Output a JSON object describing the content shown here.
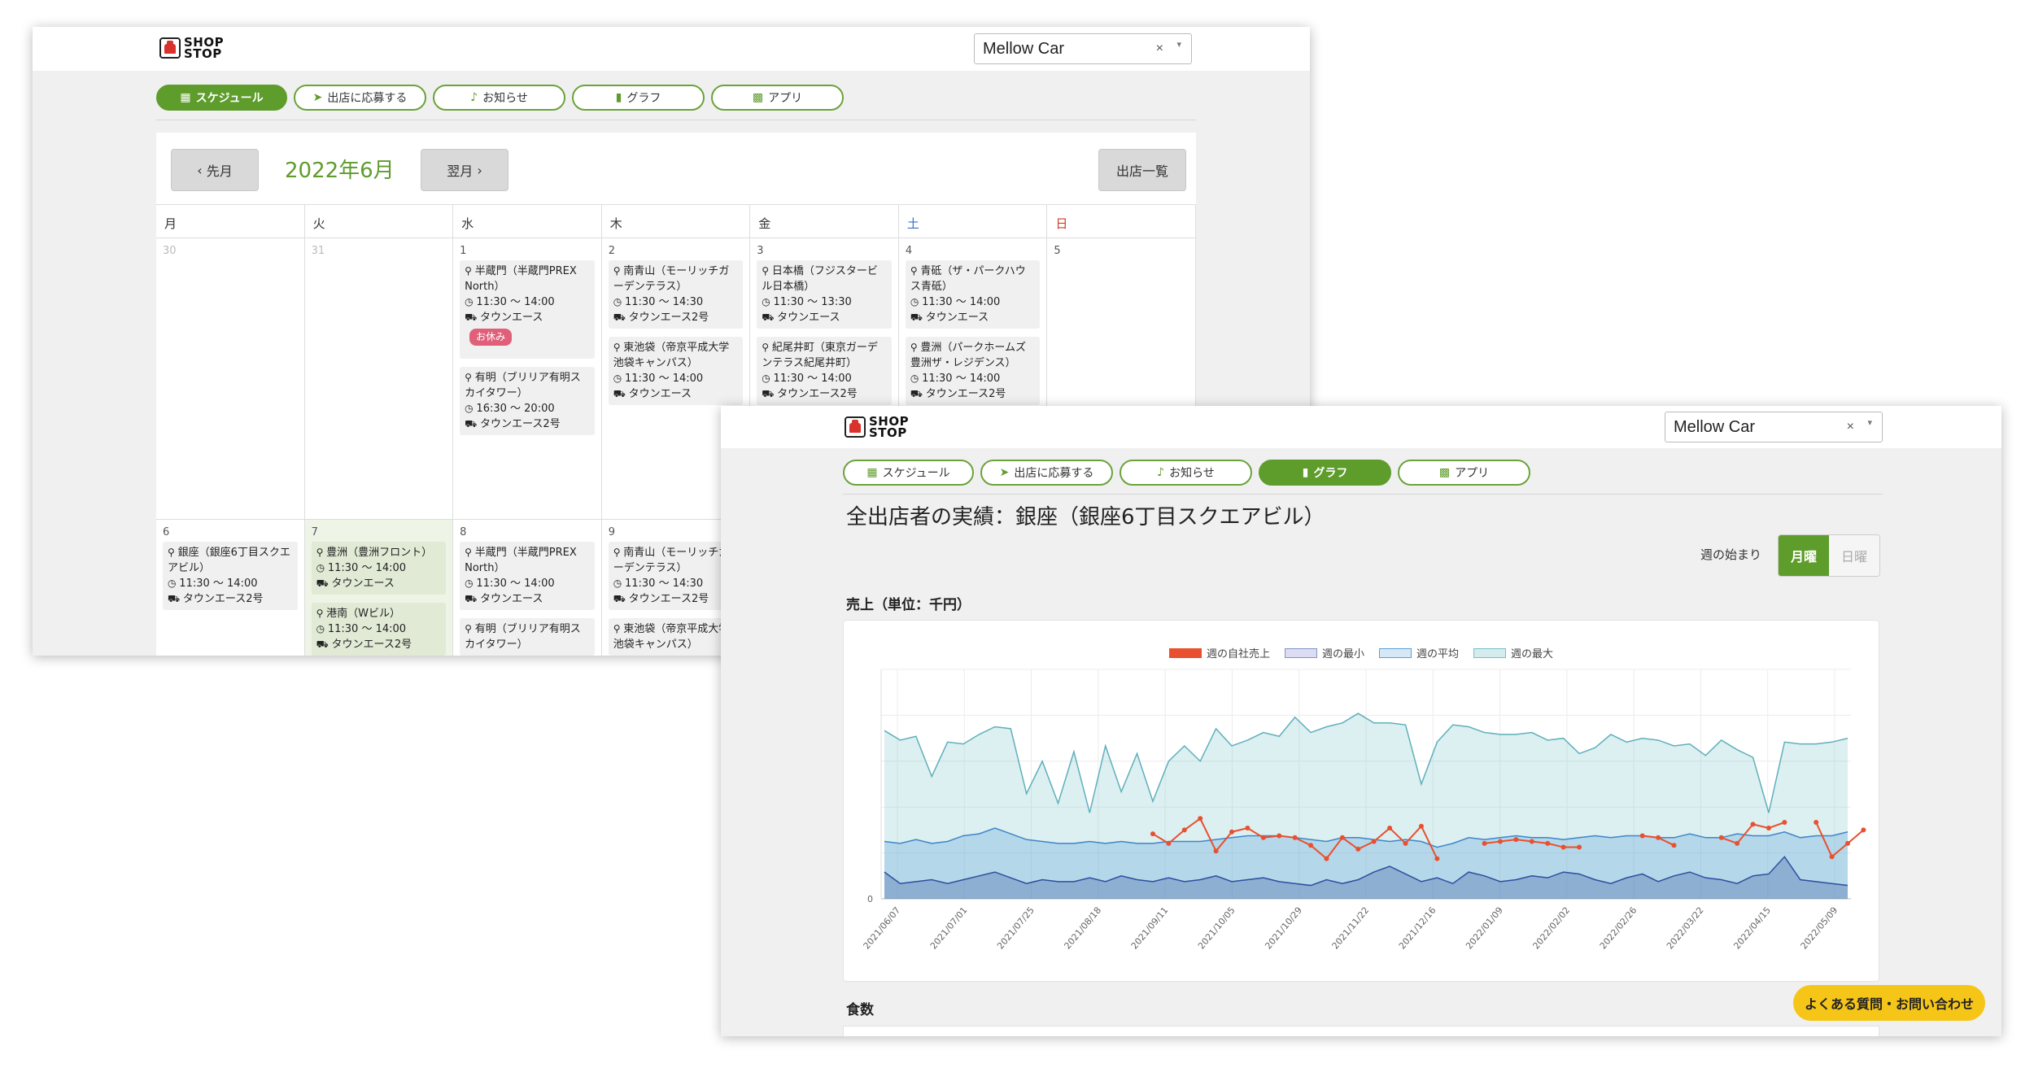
{
  "app": {
    "logo_line1": "SHOP",
    "logo_line2": "STOP"
  },
  "store_select": {
    "value": "Mellow Car",
    "clear": "×",
    "caret": "▾"
  },
  "nav": {
    "schedule": "スケジュール",
    "apply": "出店に応募する",
    "news": "お知らせ",
    "graph": "グラフ",
    "app": "アプリ"
  },
  "calendar": {
    "prev": "先月",
    "next": "翌月",
    "month_title": "2022年6月",
    "list_button": "出店一覧",
    "weekdays": [
      "月",
      "火",
      "水",
      "木",
      "金",
      "土",
      "日"
    ],
    "week1": [
      {
        "date": "30",
        "muted": true,
        "events": []
      },
      {
        "date": "31",
        "muted": true,
        "events": []
      },
      {
        "date": "1",
        "events": [
          {
            "place": "半蔵門（半蔵門PREX North）",
            "time": "11:30 〜 14:00",
            "truck": "タウンエース",
            "badge": "お休み"
          },
          {
            "place": "有明（ブリリア有明スカイタワー）",
            "time": "16:30 〜 20:00",
            "truck": "タウンエース2号"
          }
        ]
      },
      {
        "date": "2",
        "events": [
          {
            "place": "南青山（モーリッチガーデンテラス）",
            "time": "11:30 〜 14:30",
            "truck": "タウンエース2号"
          },
          {
            "place": "東池袋（帝京平成大学池袋キャンパス）",
            "time": "11:30 〜 14:00",
            "truck": "タウンエース"
          }
        ]
      },
      {
        "date": "3",
        "events": [
          {
            "place": "日本橋（フジスタービル日本橋）",
            "time": "11:30 〜 13:30",
            "truck": "タウンエース"
          },
          {
            "place": "紀尾井町（東京ガーデンテラス紀尾井町）",
            "time": "11:30 〜 14:00",
            "truck": "タウンエース2号"
          }
        ]
      },
      {
        "date": "4",
        "events": [
          {
            "place": "青砥（ザ・パークハウス青砥）",
            "time": "11:30 〜 14:00",
            "truck": "タウンエース"
          },
          {
            "place": "豊洲（パークホームズ豊洲ザ・レジデンス）",
            "time": "11:30 〜 14:00",
            "truck": "タウンエース2号"
          }
        ]
      },
      {
        "date": "5",
        "events": []
      }
    ],
    "week2": [
      {
        "date": "6",
        "events": [
          {
            "place": "銀座（銀座6丁目スクエアビル）",
            "time": "11:30 〜 14:00",
            "truck": "タウンエース2号"
          }
        ]
      },
      {
        "date": "7",
        "today": true,
        "events": [
          {
            "place": "豊洲（豊洲フロント）",
            "time": "11:30 〜 14:00",
            "truck": "タウンエース"
          },
          {
            "place": "港南（Wビル）",
            "time": "11:30 〜 14:00",
            "truck": "タウンエース2号"
          }
        ]
      },
      {
        "date": "8",
        "events": [
          {
            "place": "半蔵門（半蔵門PREX North）",
            "time": "11:30 〜 14:00",
            "truck": "タウンエース"
          },
          {
            "place": "有明（ブリリア有明スカイタワー）",
            "time": "",
            "truck": ""
          }
        ]
      },
      {
        "date": "9",
        "events": [
          {
            "place": "南青山（モーリッチガーデンテラス）",
            "time": "11:30 〜 14:30",
            "truck": "タウンエース2号"
          },
          {
            "place": "東池袋（帝京平成大学池袋キャンパス）",
            "time": "",
            "truck": ""
          }
        ]
      },
      {
        "date": "",
        "events": []
      },
      {
        "date": "",
        "events": []
      },
      {
        "date": "",
        "events": []
      }
    ]
  },
  "graph_page": {
    "title": "全出店者の実績：銀座（銀座6丁目スクエアビル）",
    "week_start_label": "週の始まり",
    "toggle_on": "月曜",
    "toggle_off": "日曜",
    "sales_label": "売上（単位：千円）",
    "meals_label": "食数",
    "help_button": "よくある質問・お問い合わせ"
  },
  "colors": {
    "accent": "#5e9c2c",
    "own_sales": "#e8502f",
    "week_min": "#7f95c9",
    "week_avg": "#5aa0d8",
    "week_max": "#74c0c9",
    "help": "#f5c518"
  },
  "chart_data": {
    "type": "area",
    "legend": [
      "週の自社売上",
      "週の最小",
      "週の平均",
      "週の最大"
    ],
    "x_tick_labels": [
      "2021/06/07",
      "2021/07/01",
      "2021/07/25",
      "2021/08/18",
      "2021/09/11",
      "2021/10/05",
      "2021/10/29",
      "2021/11/22",
      "2021/12/16",
      "2022/01/09",
      "2022/02/02",
      "2022/02/26",
      "2022/03/22",
      "2022/04/15",
      "2022/05/09"
    ],
    "y_tick_labels": [
      "0"
    ],
    "grid": true,
    "legend_position": "top",
    "series": [
      {
        "name": "週の最大",
        "values": [
          88,
          83,
          85,
          64,
          82,
          81,
          86,
          90,
          89,
          55,
          72,
          50,
          77,
          45,
          80,
          56,
          76,
          51,
          72,
          80,
          72,
          89,
          80,
          83,
          87,
          85,
          95,
          87,
          90,
          92,
          97,
          92,
          92,
          91,
          60,
          82,
          91,
          90,
          87,
          86,
          86,
          87,
          83,
          84,
          76,
          79,
          86,
          82,
          84,
          83,
          80,
          81,
          75,
          83,
          78,
          74,
          45,
          82,
          81,
          81,
          82,
          84
        ]
      },
      {
        "name": "週の平均",
        "values": [
          30,
          29,
          31,
          29,
          30,
          33,
          34,
          37,
          34,
          31,
          30,
          29,
          29,
          30,
          29,
          30,
          29,
          29,
          30,
          30,
          30,
          31,
          32,
          33,
          33,
          33,
          32,
          31,
          30,
          32,
          32,
          31,
          30,
          31,
          30,
          27,
          29,
          32,
          31,
          32,
          33,
          32,
          32,
          31,
          32,
          33,
          32,
          33,
          33,
          32,
          32,
          34,
          32,
          32,
          34,
          33,
          33,
          35,
          32,
          33,
          33,
          35
        ]
      },
      {
        "name": "週の最小",
        "values": [
          14,
          8,
          9,
          10,
          8,
          10,
          12,
          14,
          11,
          8,
          10,
          9,
          9,
          11,
          9,
          12,
          10,
          9,
          11,
          9,
          10,
          12,
          9,
          10,
          11,
          9,
          8,
          7,
          10,
          8,
          10,
          14,
          17,
          13,
          9,
          11,
          8,
          14,
          12,
          9,
          10,
          12,
          11,
          14,
          13,
          10,
          8,
          11,
          13,
          9,
          12,
          14,
          11,
          10,
          8,
          12,
          13,
          22,
          10,
          9,
          8,
          7
        ]
      },
      {
        "name": "週の自社売上",
        "values": [
          null,
          null,
          null,
          null,
          null,
          null,
          null,
          null,
          null,
          null,
          null,
          null,
          null,
          null,
          null,
          null,
          null,
          34,
          29,
          36,
          42,
          25,
          35,
          37,
          32,
          33,
          32,
          28,
          21,
          32,
          26,
          30,
          37,
          29,
          38,
          21,
          null,
          null,
          29,
          30,
          31,
          30,
          29,
          27,
          27,
          null,
          null,
          null,
          33,
          32,
          28,
          null,
          null,
          32,
          29,
          39,
          37,
          40,
          null,
          40,
          22,
          29,
          36
        ]
      }
    ]
  }
}
